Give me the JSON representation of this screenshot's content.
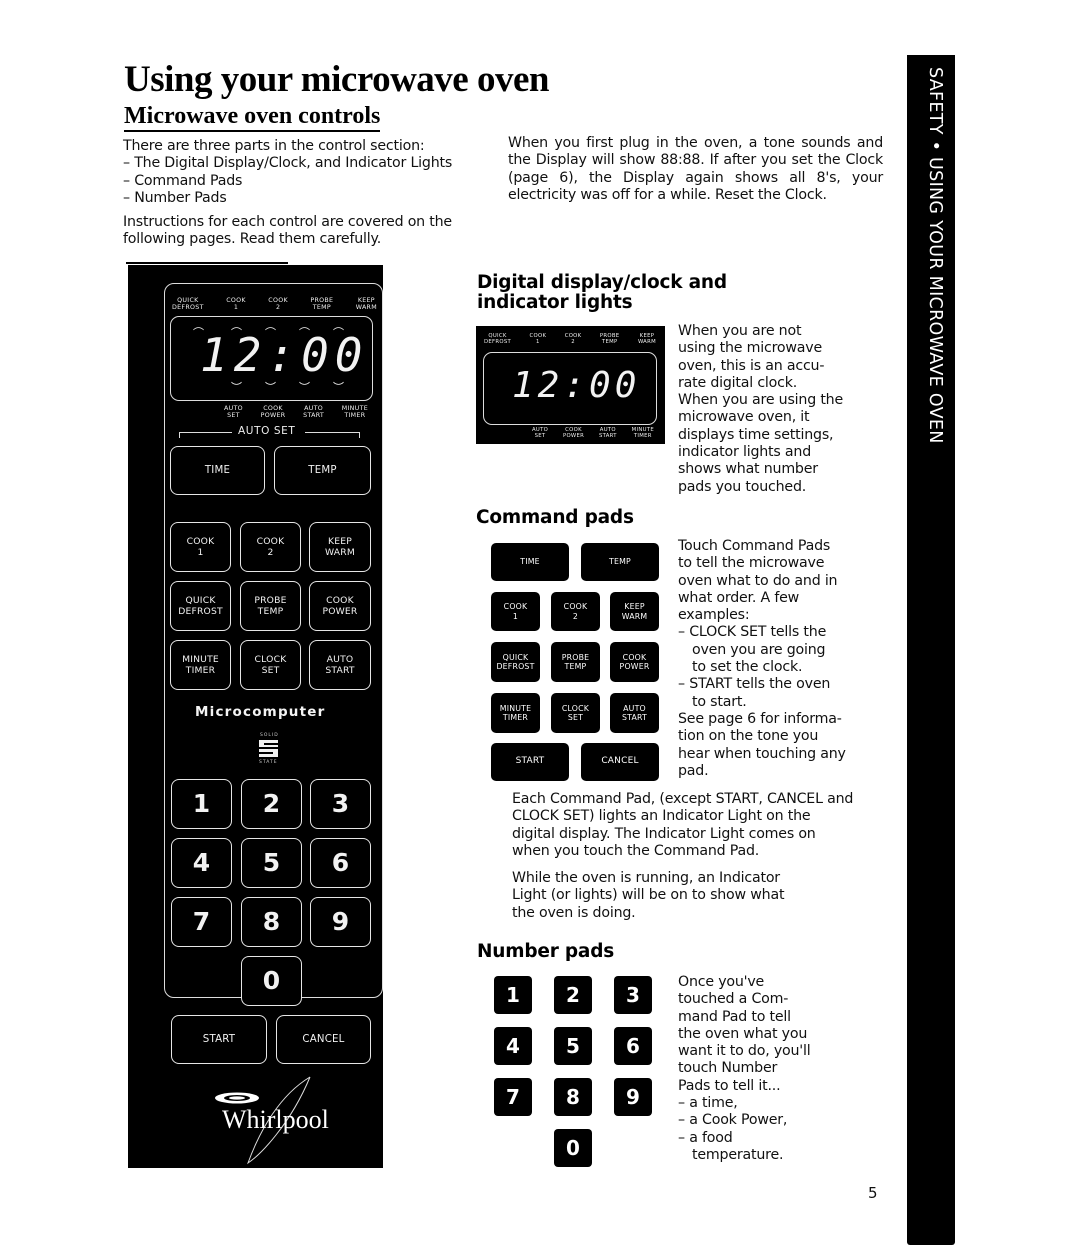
{
  "header": {
    "title": "Using your microwave oven",
    "subtitle": "Microwave oven controls"
  },
  "intro": {
    "lead": "There are three parts in the control section:",
    "parts": [
      "– The Digital Display/Clock, and Indicator Lights",
      "– Command Pads",
      "– Number Pads"
    ],
    "instructions": "Instructions for each control are covered on the following pages. Read them carefully.",
    "plug_in_note": "When you first plug in the oven, a tone sounds and the Display will show 88:88. If after you set the Clock (page 6), the Display again shows all 8's, your electricity was off for a while. Reset the Clock."
  },
  "side_tab": {
    "label": "SAFETY • USING YOUR MICROWAVE OVEN"
  },
  "control_panel": {
    "top_indicators": [
      {
        "line1": "QUICK",
        "line2": "DEFROST"
      },
      {
        "line1": "COOK",
        "line2": "1"
      },
      {
        "line1": "COOK",
        "line2": "2"
      },
      {
        "line1": "PROBE",
        "line2": "TEMP"
      },
      {
        "line1": "KEEP",
        "line2": "WARM"
      }
    ],
    "display_time": "12:00",
    "bottom_indicators": [
      {
        "line1": "AUTO",
        "line2": "SET"
      },
      {
        "line1": "COOK",
        "line2": "POWER"
      },
      {
        "line1": "AUTO",
        "line2": "START"
      },
      {
        "line1": "MINUTE",
        "line2": "TIMER"
      }
    ],
    "auto_set_label": "AUTO SET",
    "auto_set_pads": [
      "TIME",
      "TEMP"
    ],
    "command_pads": [
      {
        "line1": "COOK",
        "line2": "1"
      },
      {
        "line1": "COOK",
        "line2": "2"
      },
      {
        "line1": "KEEP",
        "line2": "WARM"
      },
      {
        "line1": "QUICK",
        "line2": "DEFROST"
      },
      {
        "line1": "PROBE",
        "line2": "TEMP"
      },
      {
        "line1": "COOK",
        "line2": "POWER"
      },
      {
        "line1": "MINUTE",
        "line2": "TIMER"
      },
      {
        "line1": "CLOCK",
        "line2": "SET"
      },
      {
        "line1": "AUTO",
        "line2": "START"
      }
    ],
    "microcomputer_label": "Microcomputer",
    "solid_state_top": "SOLID",
    "solid_state_bottom": "STATE",
    "number_pads": [
      "1",
      "2",
      "3",
      "4",
      "5",
      "6",
      "7",
      "8",
      "9",
      "0"
    ],
    "start_label": "START",
    "cancel_label": "CANCEL",
    "brand": "Whirlpool"
  },
  "digital_display_section": {
    "heading_line1": "Digital display/clock and",
    "heading_line2": "indicator lights",
    "description": [
      "When you are not",
      "using the microwave",
      "oven, this is an accu-",
      "rate digital clock.",
      "When you are using the",
      "microwave oven, it",
      "displays time settings,",
      "indicator lights and",
      "shows what number",
      "pads you touched."
    ]
  },
  "command_pads_section": {
    "heading": "Command pads",
    "pads": {
      "time": "TIME",
      "temp": "TEMP",
      "grid": [
        {
          "line1": "COOK",
          "line2": "1"
        },
        {
          "line1": "COOK",
          "line2": "2"
        },
        {
          "line1": "KEEP",
          "line2": "WARM"
        },
        {
          "line1": "QUICK",
          "line2": "DEFROST"
        },
        {
          "line1": "PROBE",
          "line2": "TEMP"
        },
        {
          "line1": "COOK",
          "line2": "POWER"
        },
        {
          "line1": "MINUTE",
          "line2": "TIMER"
        },
        {
          "line1": "CLOCK",
          "line2": "SET"
        },
        {
          "line1": "AUTO",
          "line2": "START"
        }
      ],
      "start": "START",
      "cancel": "CANCEL"
    },
    "description": [
      "Touch Command Pads",
      "to tell the microwave",
      "oven what to do and in",
      "what order. A few",
      "examples:",
      "– CLOCK SET tells the",
      "oven you are going",
      "to set the clock.",
      "– START tells the oven",
      "to start.",
      "See page 6 for informa-",
      "tion on the tone you",
      "hear when touching any",
      "pad."
    ],
    "note1": "Each Command Pad, (except START, CANCEL and CLOCK SET) lights an Indicator Light on the digital display. The Indicator Light comes on when you touch the Command Pad.",
    "note2": "While the oven is running, an Indicator Light (or lights) will be on to show what the oven is doing."
  },
  "number_pads_section": {
    "heading": "Number pads",
    "pads": [
      "1",
      "2",
      "3",
      "4",
      "5",
      "6",
      "7",
      "8",
      "9",
      "0"
    ],
    "description": [
      "Once you've",
      "touched a Com-",
      "mand Pad to tell",
      "the oven what you",
      "want it to do, you'll",
      "touch Number",
      "Pads to tell it...",
      "– a time,",
      "– a Cook Power,",
      "– a food",
      "temperature."
    ]
  },
  "page_number": "5"
}
